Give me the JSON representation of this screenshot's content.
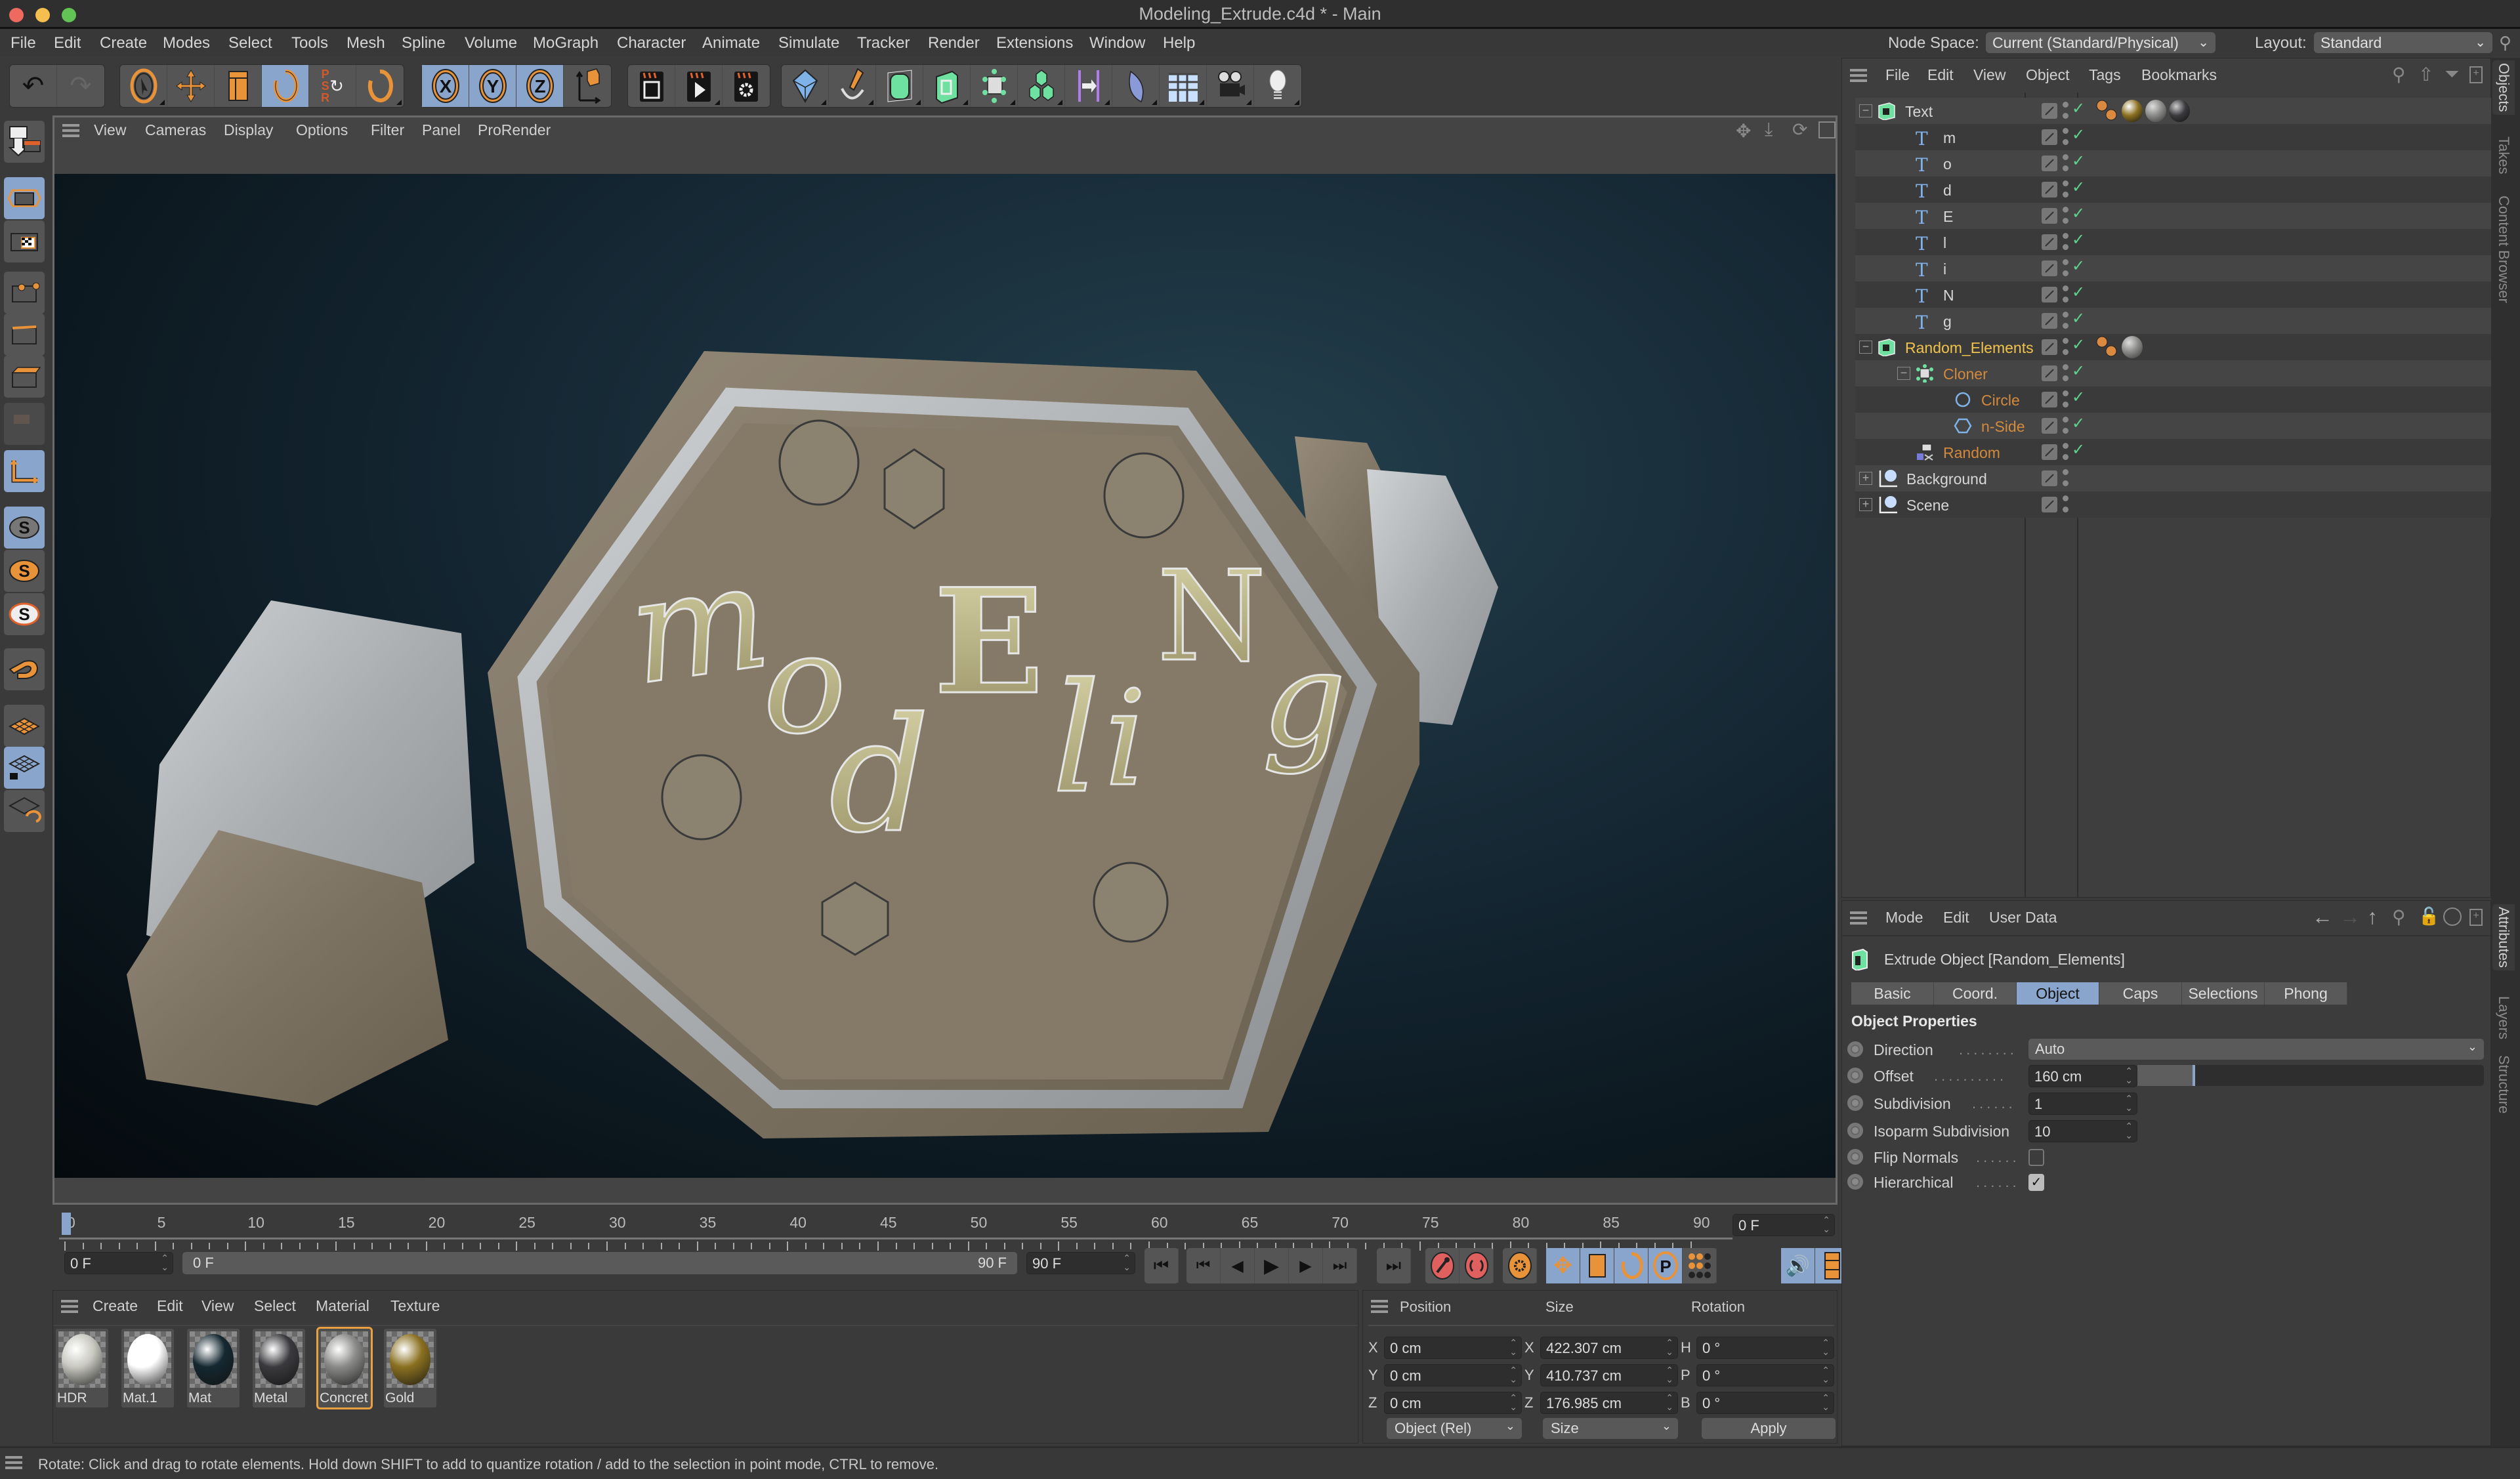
{
  "window": {
    "title": "Modeling_Extrude.c4d * - Main",
    "traffic_lights": {
      "close": "#ee6a5f",
      "minimize": "#f5bf4f",
      "maximize": "#61c454"
    }
  },
  "menubar": {
    "items": [
      "File",
      "Edit",
      "Create",
      "Modes",
      "Select",
      "Tools",
      "Mesh",
      "Spline",
      "Volume",
      "MoGraph",
      "Character",
      "Animate",
      "Simulate",
      "Tracker",
      "Render",
      "Extensions",
      "Window",
      "Help"
    ],
    "node_space_label": "Node Space:",
    "node_space_value": "Current (Standard/Physical)",
    "layout_label": "Layout:",
    "layout_value": "Standard"
  },
  "toolbar": {
    "groups": [
      [
        "undo-icon",
        "redo-icon"
      ],
      [
        "live-selection-icon",
        "move-icon",
        "scale-icon",
        "rotate-icon",
        "psr-reset-icon",
        "recent-tool-icon"
      ],
      [
        "x-axis-lock-icon",
        "y-axis-lock-icon",
        "z-axis-lock-icon",
        "coordinate-system-icon"
      ],
      [
        "render-view-icon",
        "render-to-picture-viewer-icon",
        "render-settings-icon"
      ],
      [
        "cube-icon",
        "pen-spline-icon",
        "subdivision-surface-icon",
        "extrude-generator-icon",
        "cloner-icon",
        "fracture-icon",
        "symmetry-deformer-icon",
        "field-icon",
        "floor-environment-icon",
        "camera-icon",
        "light-icon"
      ]
    ],
    "active": [
      "rotate-icon",
      "x-axis-lock-icon",
      "y-axis-lock-icon",
      "z-axis-lock-icon"
    ]
  },
  "left_toolbar": {
    "items": [
      "make-editable-icon",
      "model-mode-icon",
      "texture-mode-icon",
      "point-mode-icon",
      "edge-mode-icon",
      "polygon-mode-icon",
      "uv-mode-icon",
      "axis-mode-icon",
      "solo-off-icon",
      "solo-single-icon",
      "solo-hierarchy-icon",
      "snap-magnet-icon",
      "workplane-icon",
      "locked-workplane-icon",
      "workplane-align-icon"
    ],
    "active": [
      "model-mode-icon",
      "axis-mode-icon",
      "solo-off-icon",
      "locked-workplane-icon"
    ]
  },
  "viewport": {
    "menu": [
      "View",
      "Cameras",
      "Display",
      "Options",
      "Filter",
      "Panel",
      "ProRender"
    ],
    "nav_icons": [
      "pan-icon",
      "dolly-icon",
      "orbit-icon",
      "maximize-view-icon"
    ],
    "render_text": [
      "m",
      "o",
      "d",
      "E",
      "l",
      "i",
      "N",
      "g"
    ]
  },
  "timeline": {
    "ticks": [
      "0",
      "5",
      "10",
      "15",
      "20",
      "25",
      "30",
      "35",
      "40",
      "45",
      "50",
      "55",
      "60",
      "65",
      "70",
      "75",
      "80",
      "85",
      "90"
    ],
    "current_frame_display": "0 F",
    "start_field": "0 F",
    "range_start": "0 F",
    "range_end": "90 F",
    "end_field": "90 F",
    "playhead_frame": 0,
    "max_frame": 90
  },
  "playback": {
    "buttons": [
      "go-to-start-icon",
      "go-to-prev-key-icon",
      "prev-frame-icon",
      "play-icon",
      "next-frame-icon",
      "go-to-next-key-icon",
      "go-to-end-icon"
    ],
    "key_buttons": [
      "record-key-icon",
      "autokey-icon",
      "keyframe-selection-icon",
      "key-position-icon",
      "key-scale-icon",
      "key-rotation-icon",
      "key-param-icon",
      "key-pla-icon",
      "sound-icon",
      "timeline-icon"
    ]
  },
  "materials": {
    "menu": [
      "Create",
      "Edit",
      "View",
      "Select",
      "Material",
      "Texture"
    ],
    "items": [
      {
        "name": "HDR",
        "color": "#c8c8c0",
        "selected": false
      },
      {
        "name": "Mat.1",
        "color": "#ffffff",
        "selected": false
      },
      {
        "name": "Mat",
        "color": "#152831",
        "selected": false
      },
      {
        "name": "Metal",
        "color": "#3a3a3e",
        "selected": false
      },
      {
        "name": "Concret",
        "color": "#8a8a88",
        "selected": true
      },
      {
        "name": "Gold",
        "color": "#8a7020",
        "selected": false
      }
    ],
    "selection_color": "#e8a040"
  },
  "coordinates": {
    "headers": [
      "Position",
      "Size",
      "Rotation"
    ],
    "position": [
      {
        "axis": "X",
        "value": "0 cm"
      },
      {
        "axis": "Y",
        "value": "0 cm"
      },
      {
        "axis": "Z",
        "value": "0 cm"
      }
    ],
    "size": [
      {
        "axis": "X",
        "value": "422.307 cm"
      },
      {
        "axis": "Y",
        "value": "410.737 cm"
      },
      {
        "axis": "Z",
        "value": "176.985 cm"
      }
    ],
    "rotation": [
      {
        "axis": "H",
        "value": "0 °"
      },
      {
        "axis": "P",
        "value": "0 °"
      },
      {
        "axis": "B",
        "value": "0 °"
      }
    ],
    "mode_dropdown": "Object (Rel)",
    "size_dropdown": "Size",
    "apply_label": "Apply"
  },
  "objects_panel": {
    "menu": [
      "File",
      "Edit",
      "View",
      "Object",
      "Tags",
      "Bookmarks"
    ],
    "tree": [
      {
        "name": "Text",
        "level": 0,
        "type": "extrude",
        "color": "#d6d6d6",
        "expanded": true,
        "check": true,
        "tags": [
          "phong",
          "gold-mat",
          "concrete-mat",
          "metal-mat"
        ]
      },
      {
        "name": "m",
        "level": 1,
        "type": "text",
        "color": "#d6d6d6",
        "check": true
      },
      {
        "name": "o",
        "level": 1,
        "type": "text",
        "color": "#d6d6d6",
        "check": true
      },
      {
        "name": "d",
        "level": 1,
        "type": "text",
        "color": "#d6d6d6",
        "check": true
      },
      {
        "name": "E",
        "level": 1,
        "type": "text",
        "color": "#d6d6d6",
        "check": true
      },
      {
        "name": "l",
        "level": 1,
        "type": "text",
        "color": "#d6d6d6",
        "check": true
      },
      {
        "name": "i",
        "level": 1,
        "type": "text",
        "color": "#d6d6d6",
        "check": true
      },
      {
        "name": "N",
        "level": 1,
        "type": "text",
        "color": "#d6d6d6",
        "check": true
      },
      {
        "name": "g",
        "level": 1,
        "type": "text",
        "color": "#d6d6d6",
        "check": true
      },
      {
        "name": "Random_Elements",
        "level": 0,
        "type": "extrude",
        "color": "#f1c34c",
        "expanded": true,
        "check": true,
        "tags": [
          "phong",
          "concrete-mat"
        ]
      },
      {
        "name": "Cloner",
        "level": 1,
        "type": "cloner",
        "color": "#d38a3c",
        "expanded": true,
        "check": true
      },
      {
        "name": "Circle",
        "level": 2,
        "type": "circle",
        "color": "#d38a3c",
        "check": true
      },
      {
        "name": "n-Side",
        "level": 2,
        "type": "nside",
        "color": "#d38a3c",
        "check": true
      },
      {
        "name": "Random",
        "level": 1,
        "type": "random",
        "color": "#d38a3c",
        "check": true
      },
      {
        "name": "Background",
        "level": 0,
        "type": "null",
        "color": "#d6d6d6",
        "expanded": false,
        "check": false
      },
      {
        "name": "Scene",
        "level": 0,
        "type": "null",
        "color": "#d6d6d6",
        "expanded": false,
        "check": false
      }
    ]
  },
  "attributes_panel": {
    "menu": [
      "Mode",
      "Edit",
      "User Data"
    ],
    "object_title": "Extrude Object [Random_Elements]",
    "tabs": [
      "Basic",
      "Coord.",
      "Object",
      "Caps",
      "Selections",
      "Phong"
    ],
    "active_tab": "Object",
    "section_title": "Object Properties",
    "properties": {
      "direction": {
        "label": "Direction",
        "value": "Auto"
      },
      "offset": {
        "label": "Offset",
        "value": "160 cm",
        "slider_fraction": 0.16
      },
      "subdivision": {
        "label": "Subdivision",
        "value": "1"
      },
      "isoparm": {
        "label": "Isoparm Subdivision",
        "value": "10"
      },
      "flip_normals": {
        "label": "Flip Normals",
        "checked": false
      },
      "hierarchical": {
        "label": "Hierarchical",
        "checked": true
      }
    }
  },
  "side_tabs": {
    "top": [
      "Objects",
      "Takes",
      "Content Browser"
    ],
    "bottom": [
      "Attributes",
      "Layers",
      "Structure"
    ],
    "active_top": "Objects",
    "active_bottom": "Attributes"
  },
  "status": {
    "text": "Rotate: Click and drag to rotate elements. Hold down SHIFT to add to quantize rotation / add to the selection in point mode, CTRL to remove."
  },
  "colors": {
    "accent_blue": "#8aa5cc",
    "orange": "#e8923a",
    "check_green": "#5ed28c"
  }
}
